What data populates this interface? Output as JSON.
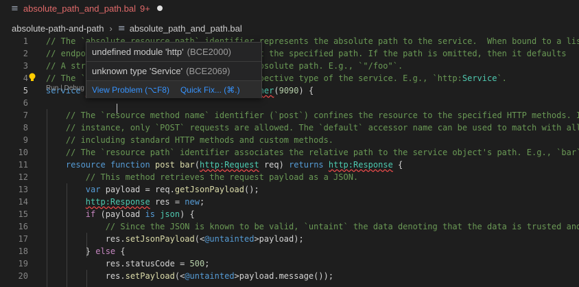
{
  "tab": {
    "icon": "lines-icon",
    "filename": "absolute_path_and_path.bal",
    "problem_count": "9+"
  },
  "breadcrumb": {
    "folder": "absolute-path-and-path",
    "separator": "›",
    "file": "absolute_path_and_path.bal"
  },
  "codelens": {
    "text": "Run | Debug"
  },
  "hover": {
    "problem1": {
      "message": "undefined module 'http'",
      "code": "(BCE2000)"
    },
    "problem2": {
      "message": "unknown type 'Service'",
      "code": "(BCE2069)"
    },
    "view_problem": "View Problem (⌥F8)",
    "quick_fix": "Quick Fix... (⌘.)"
  },
  "lines": [
    {
      "n": "1",
      "tokens": [
        [
          "cm",
          "// The `absolute resource path` identifier represents the absolute path to the service.  When bound to a lis"
        ]
      ]
    },
    {
      "n": "2",
      "tokens": [
        [
          "cm",
          "// endpo                                  at the specified path. If the path is omitted, then it defaults"
        ]
      ]
    },
    {
      "n": "3",
      "tokens": [
        [
          "cm",
          "// A str                                  absolute path. E.g., `\"/foo\"`."
        ]
      ]
    },
    {
      "n": "4",
      "tokens": [
        [
          "cm",
          "// The `                                  spective type of the service. E.g., `http:"
        ],
        [
          "ty",
          "Service"
        ],
        [
          "cm",
          "`."
        ]
      ]
    },
    {
      "n": "5",
      "tokens": [
        [
          "kw",
          "service "
        ],
        [
          "sq",
          "http:Service"
        ],
        [
          "",
          " /foo "
        ],
        [
          "kw",
          "on "
        ],
        [
          "kw",
          "new "
        ],
        [
          "sq",
          "http:Listener"
        ],
        [
          "",
          "("
        ],
        [
          "num",
          "9090"
        ],
        [
          "",
          ") {"
        ]
      ]
    },
    {
      "n": "6",
      "tokens": []
    },
    {
      "n": "7",
      "tokens": [
        [
          "",
          "    "
        ],
        [
          "cm",
          "// The `resource method name` identifier (`post`) confines the resource to the specified HTTP methods. I"
        ]
      ]
    },
    {
      "n": "8",
      "tokens": [
        [
          "",
          "    "
        ],
        [
          "cm",
          "// instance, only `POST` requests are allowed. The `default` accessor name can be used to match with all"
        ]
      ]
    },
    {
      "n": "9",
      "tokens": [
        [
          "",
          "    "
        ],
        [
          "cm",
          "// including standard HTTP methods and custom methods."
        ]
      ]
    },
    {
      "n": "10",
      "tokens": [
        [
          "",
          "    "
        ],
        [
          "cm",
          "// The `resource path` identifier associates the relative path to the service object's path. E.g., `bar`"
        ]
      ]
    },
    {
      "n": "11",
      "tokens": [
        [
          "",
          "    "
        ],
        [
          "kw",
          "resource "
        ],
        [
          "kw",
          "function "
        ],
        [
          "fn",
          "post "
        ],
        [
          "fn",
          "bar"
        ],
        [
          "",
          "("
        ],
        [
          "sq",
          "http:Request"
        ],
        [
          "",
          " req) "
        ],
        [
          "kw",
          "returns "
        ],
        [
          "sq",
          "http:Response"
        ],
        [
          "",
          " {"
        ]
      ]
    },
    {
      "n": "12",
      "tokens": [
        [
          "",
          "        "
        ],
        [
          "cm",
          "// This method retrieves the request payload as a JSON."
        ]
      ]
    },
    {
      "n": "13",
      "tokens": [
        [
          "",
          "        "
        ],
        [
          "kw",
          "var "
        ],
        [
          "",
          "payload = req."
        ],
        [
          "fn",
          "getJsonPayload"
        ],
        [
          "",
          "();"
        ]
      ]
    },
    {
      "n": "14",
      "tokens": [
        [
          "",
          "        "
        ],
        [
          "sq",
          "http:Response"
        ],
        [
          "",
          " res = "
        ],
        [
          "kw",
          "new"
        ],
        [
          "",
          ";"
        ]
      ]
    },
    {
      "n": "15",
      "tokens": [
        [
          "",
          "        "
        ],
        [
          "kc",
          "if "
        ],
        [
          "",
          "(payload "
        ],
        [
          "kw",
          "is "
        ],
        [
          "ty",
          "json"
        ],
        [
          "",
          ") {"
        ]
      ]
    },
    {
      "n": "16",
      "tokens": [
        [
          "",
          "            "
        ],
        [
          "cm",
          "// Since the JSON is known to be valid, `untaint` the data denoting that the data is trusted and"
        ]
      ]
    },
    {
      "n": "17",
      "tokens": [
        [
          "",
          "            res."
        ],
        [
          "fn",
          "setJsonPayload"
        ],
        [
          "",
          "(<"
        ],
        [
          "kw",
          "@untainted"
        ],
        [
          "",
          ">payload);"
        ]
      ]
    },
    {
      "n": "18",
      "tokens": [
        [
          "",
          "        } "
        ],
        [
          "kc",
          "else "
        ],
        [
          "",
          "{"
        ]
      ]
    },
    {
      "n": "19",
      "tokens": [
        [
          "",
          "            res.statusCode = "
        ],
        [
          "num",
          "500"
        ],
        [
          "",
          ";"
        ]
      ]
    },
    {
      "n": "20",
      "tokens": [
        [
          "",
          "            res."
        ],
        [
          "fn",
          "setPayload"
        ],
        [
          "",
          "(<"
        ],
        [
          "kw",
          "@untainted"
        ],
        [
          "",
          ">payload.message());"
        ]
      ]
    }
  ],
  "colors": {
    "background": "#1e1e1e",
    "error": "#f14c4c",
    "link": "#3794ff"
  }
}
